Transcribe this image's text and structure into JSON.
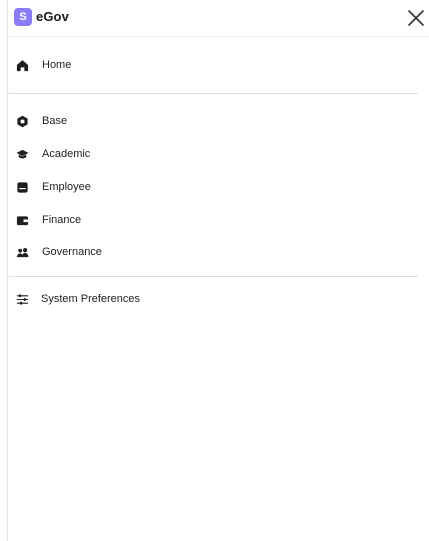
{
  "app": {
    "logo_letter": "S",
    "title": "eGov",
    "accent_color": "#8b7cf6"
  },
  "nav": {
    "home": {
      "label": "Home",
      "icon": "home-icon"
    },
    "items": [
      {
        "label": "Base",
        "icon": "hexagon-icon"
      },
      {
        "label": "Academic",
        "icon": "graduation-cap-icon"
      },
      {
        "label": "Employee",
        "icon": "id-badge-icon"
      },
      {
        "label": "Finance",
        "icon": "wallet-icon"
      },
      {
        "label": "Governance",
        "icon": "users-icon"
      }
    ],
    "preferences": {
      "label": "System Preferences",
      "icon": "sliders-icon"
    }
  }
}
